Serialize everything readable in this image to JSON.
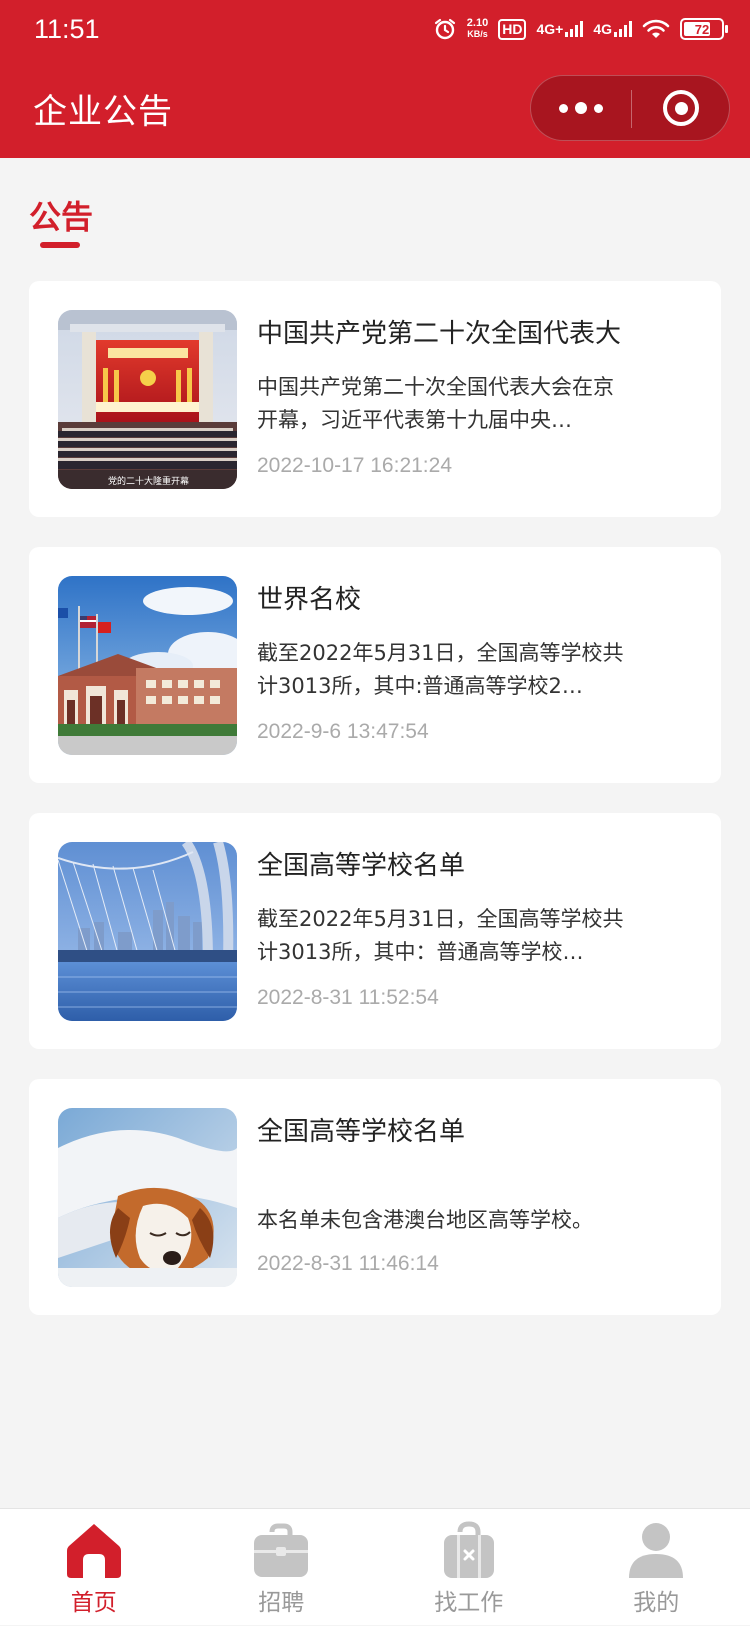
{
  "status_bar": {
    "time": "11:51",
    "speed_value": "2.10",
    "speed_unit": "KB/s",
    "hd_label": "HD",
    "net1": "4G+",
    "net2": "4G",
    "battery": "72",
    "battery_level": 0.72,
    "icons": [
      "alarm-icon",
      "hd-icon",
      "signal-4g-plus-icon",
      "signal-4g-icon",
      "wifi-icon",
      "battery-icon"
    ]
  },
  "nav": {
    "title": "企业公告",
    "icons": [
      "more-icon",
      "close-miniprogram-icon"
    ]
  },
  "section": {
    "title": "公告"
  },
  "announcements": [
    {
      "title": "中国共产党第二十次全国代表大",
      "summary": "中国共产党第二十次全国代表大会在京开幕，习近平代表第十九届中央…",
      "time": "2022-10-17 16:21:24",
      "image": "congress-hall-image",
      "image_caption": "党的二十大隆重开幕"
    },
    {
      "title": "世界名校",
      "summary": "截至2022年5月31日，全国高等学校共计3013所，其中:普通高等学校2…",
      "time": "2022-9-6 13:47:54",
      "image": "campus-building-flags-image"
    },
    {
      "title": "全国高等学校名单",
      "summary": "截至2022年5月31日，全国高等学校共计3013所，其中：普通高等学校…",
      "time": "2022-8-31 11:52:54",
      "image": "city-bridge-image"
    },
    {
      "title": "全国高等学校名单",
      "summary": "本名单未包含港澳台地区高等学校。",
      "time": "2022-8-31 11:46:14",
      "image": "sleeping-puppy-image"
    }
  ],
  "tabbar": {
    "active_color": "#d21f2b",
    "inactive_color": "#999999",
    "tabs": [
      {
        "label": "首页",
        "icon": "home-icon",
        "active": true
      },
      {
        "label": "招聘",
        "icon": "briefcase-icon",
        "active": false
      },
      {
        "label": "找工作",
        "icon": "job-bag-icon",
        "active": false
      },
      {
        "label": "我的",
        "icon": "user-icon",
        "active": false
      }
    ]
  },
  "colors": {
    "brand_red": "#d21f2b",
    "background": "#f4f4f4"
  }
}
